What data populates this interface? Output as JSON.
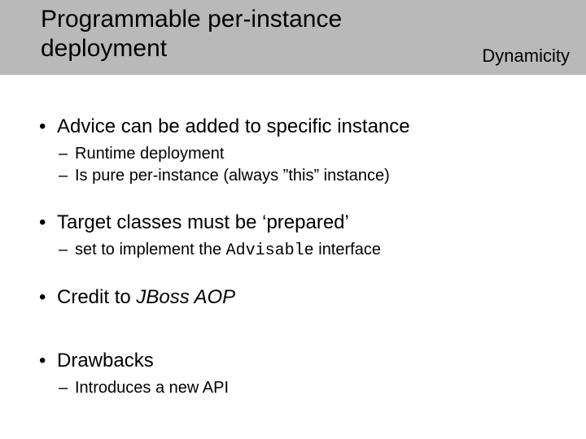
{
  "header": {
    "title": "Programmable per-instance deployment",
    "tag": "Dynamicity"
  },
  "b1": {
    "text": "Advice can be added to specific instance",
    "s1": "Runtime deployment",
    "s2": "Is pure per-instance (always ”this” instance)"
  },
  "b2": {
    "text": "Target classes must be ‘prepared’",
    "s1_a": "set to implement the ",
    "s1_code": "Advisable",
    "s1_b": " interface"
  },
  "b3": {
    "a": "Credit to ",
    "b": "JBoss AOP"
  },
  "b4": {
    "text": "Drawbacks",
    "s1": "Introduces a new API"
  }
}
